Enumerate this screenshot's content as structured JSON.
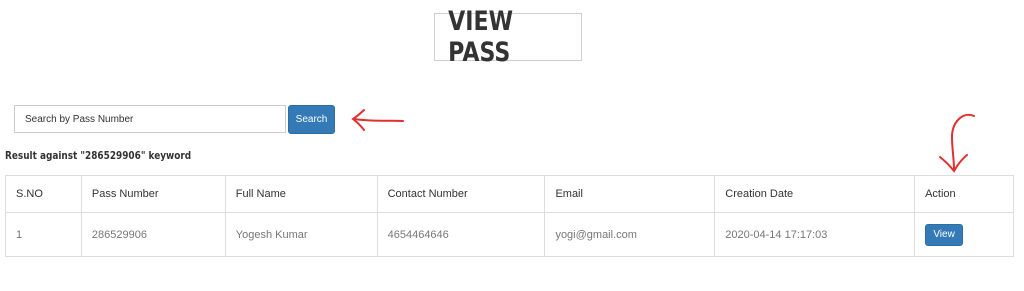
{
  "page": {
    "title": "VIEW PASS"
  },
  "search": {
    "placeholder": "Search by Pass Number",
    "button_label": "Search"
  },
  "result": {
    "message": "Result against \"286529906\" keyword"
  },
  "table": {
    "headers": [
      "S.NO",
      "Pass Number",
      "Full Name",
      "Contact Number",
      "Email",
      "Creation Date",
      "Action"
    ],
    "rows": [
      {
        "sno": "1",
        "pass_number": "286529906",
        "full_name": "Yogesh Kumar",
        "contact_number": "4654464646",
        "email": "yogi@gmail.com",
        "creation_date": "2020-04-14 17:17:03",
        "action_label": "View"
      }
    ]
  },
  "colors": {
    "primary_button": "#337ab7",
    "annotation_arrow": "#e0302f"
  },
  "annotations": [
    "arrow-left-icon",
    "arrow-down-icon"
  ]
}
